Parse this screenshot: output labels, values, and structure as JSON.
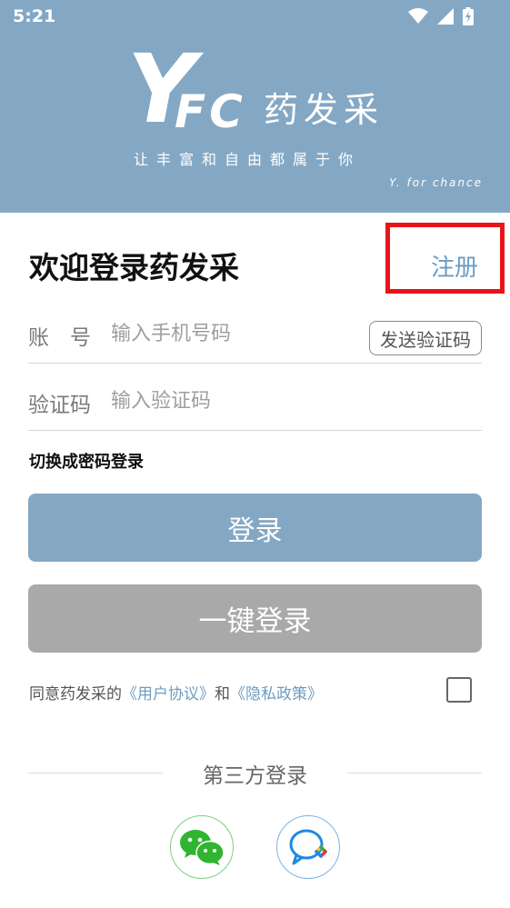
{
  "status_bar": {
    "time": "5:21",
    "icons": [
      "wifi-icon",
      "signal-icon",
      "battery-charging-icon"
    ]
  },
  "header": {
    "logo_y": "Y",
    "logo_fc": "FC",
    "logo_cn": "药发采",
    "slogan": "让丰富和自由都属于你",
    "tagline": "Y. for chance",
    "background_color": "#84a8c4"
  },
  "page": {
    "welcome": "欢迎登录药发采",
    "register_label": "注册",
    "highlight_color": "#e8141a"
  },
  "form": {
    "account_label": "账　号",
    "account_placeholder": "输入手机号码",
    "send_code_label": "发送验证码",
    "code_label": "验证码",
    "code_placeholder": "输入验证码",
    "switch_mode_label": "切换成密码登录"
  },
  "buttons": {
    "login": "登录",
    "one_key_login": "一键登录",
    "login_color": "#84a8c4",
    "one_key_color": "#a9a9a9"
  },
  "agreement": {
    "prefix": "同意药发采的",
    "user_agreement": "《用户协议》",
    "conjunction": "和",
    "privacy_policy": "《隐私政策》",
    "checked": false,
    "link_color": "#6e9cc0"
  },
  "third_party": {
    "title": "第三方登录",
    "providers": [
      "wechat-icon",
      "chat-bubble-icon"
    ]
  }
}
